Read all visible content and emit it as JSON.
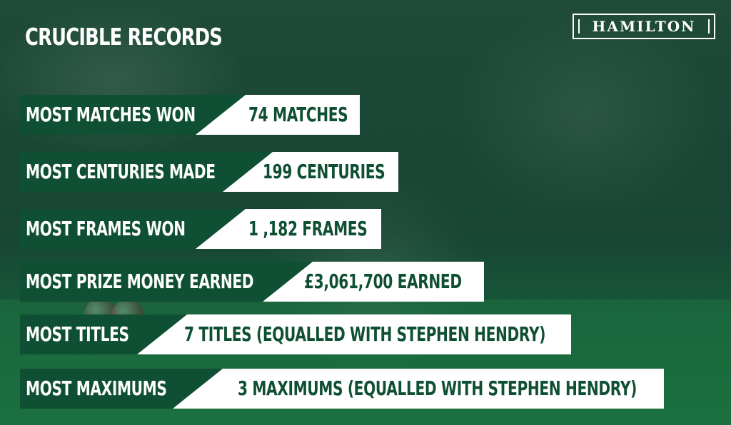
{
  "title": "CRUCIBLE RECORDS",
  "logo_text": "HAMILTON",
  "colors": {
    "accent_green": "#0f4f33",
    "panel_white": "#ffffff"
  },
  "records": [
    {
      "label": "MOST MATCHES WON",
      "value": "74 MATCHES"
    },
    {
      "label": "MOST CENTURIES MADE",
      "value": "199 CENTURIES"
    },
    {
      "label": "MOST FRAMES WON",
      "value": "1 ,182 FRAMES"
    },
    {
      "label": "MOST PRIZE MONEY EARNED",
      "value": "£3,061,700 EARNED"
    },
    {
      "label": "MOST TITLES",
      "value": "7 TITLES (EQUALLED WITH STEPHEN HENDRY)"
    },
    {
      "label": "MOST MAXIMUMS",
      "value": "3 MAXIMUMS (EQUALLED WITH STEPHEN HENDRY)"
    }
  ]
}
